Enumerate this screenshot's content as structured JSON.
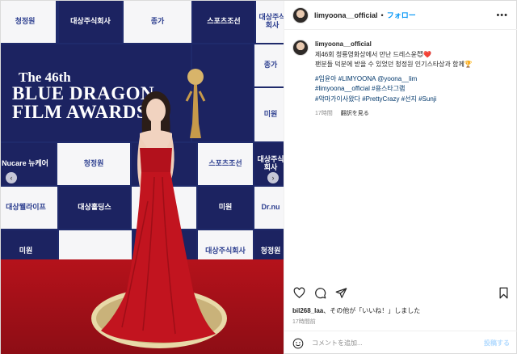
{
  "post": {
    "username": "limyoona__official",
    "follow_label": "フォロー",
    "dot": "•",
    "more_label": "•••"
  },
  "media": {
    "headline_l1": "The 46th",
    "headline_l2": "BLUE DRAGON",
    "headline_l3": "FILM AWARDS",
    "tiles": {
      "t_chungjungone_1": "청정원",
      "t_daesang_1": "대상주식회사",
      "t_jongga": "종가",
      "t_sports_1": "스포츠조선",
      "t_daesang_2": "대상주식회사",
      "t_nucare": "Nucare 뉴케어",
      "t_chungjungone_2": "청정원",
      "t_sports_2": "스포츠조선",
      "t_daesang_3": "대상주식회사",
      "t_daesang_life": "대상웰라이프",
      "t_daesang_holdings": "대상홀딩스",
      "t_miwon_1": "미원",
      "t_drnu": "Dr.nu",
      "t_miwon_2": "미원",
      "t_miwon_3": "미원",
      "t_daesang_4": "대상주식회사",
      "t_chungjungone_3": "청정원",
      "t_jongga_2": "종가"
    },
    "nav_prev": "‹",
    "nav_next": "›"
  },
  "caption": {
    "username": "limyoona__official",
    "line1": "제46회 청룡영화상에서 만난 드레스윤😈❤️",
    "line2": "팬분들 덕분에 받을 수 있었던 청정원 인기스타상과 함께🏆",
    "hashtags": [
      "#임윤아",
      "#LIMYOONA",
      "@yoona__lim",
      "#limyoona__official",
      "#용스타그램",
      "#악마가이사왔다",
      "#PrettyCrazy",
      "#선지",
      "#Sunji"
    ],
    "time": "17時間",
    "see_translation": "翻訳を見る"
  },
  "likes": {
    "user": "bil268_laa",
    "text": "、その他が「いいね！」しました"
  },
  "date": "17時間前",
  "comment": {
    "placeholder": "コメントを追加...",
    "post_label": "投稿する"
  },
  "colors": {
    "accent": "#0095f6",
    "backdrop_navy": "#1c2361",
    "carpet_red": "#b5121b",
    "dress_red": "#c2141f"
  },
  "icons": {
    "like": "heart-icon",
    "comment": "comment-icon",
    "share": "share-icon",
    "save": "bookmark-icon",
    "emoji": "emoji-icon"
  }
}
